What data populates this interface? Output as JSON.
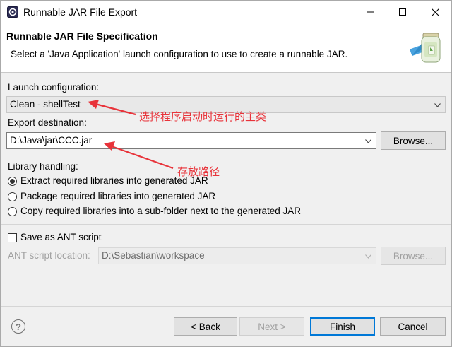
{
  "window": {
    "title": "Runnable JAR File Export",
    "minimize_label": "",
    "maximize_label": "",
    "close_label": ""
  },
  "header": {
    "title": "Runnable JAR File Specification",
    "description": "Select a 'Java Application' launch configuration to use to create a runnable JAR."
  },
  "launch": {
    "label": "Launch configuration:",
    "value": "Clean - shellTest"
  },
  "export": {
    "label": "Export destination:",
    "value": "D:\\Java\\jar\\CCC.jar",
    "browse_label": "Browse..."
  },
  "library": {
    "label": "Library handling:",
    "options": [
      {
        "label": "Extract required libraries into generated JAR",
        "selected": true
      },
      {
        "label": "Package required libraries into generated JAR",
        "selected": false
      },
      {
        "label": "Copy required libraries into a sub-folder next to the generated JAR",
        "selected": false
      }
    ]
  },
  "ant": {
    "checkbox_label": "Save as ANT script",
    "checked": false,
    "location_label": "ANT script location:",
    "location_value": "D:\\Sebastian\\workspace",
    "browse_label": "Browse..."
  },
  "footer": {
    "back_label": "< Back",
    "next_label": "Next >",
    "finish_label": "Finish",
    "cancel_label": "Cancel"
  },
  "annotations": {
    "launch_note": "选择程序启动时运行的主类",
    "export_note": "存放路径"
  },
  "colors": {
    "annotation": "#e8333a",
    "focus": "#0078d7"
  },
  "icons": [
    "app-icon",
    "minimize-icon",
    "maximize-icon",
    "close-icon",
    "jar-wizard-icon",
    "dropdown-arrow-icon",
    "help-icon"
  ]
}
